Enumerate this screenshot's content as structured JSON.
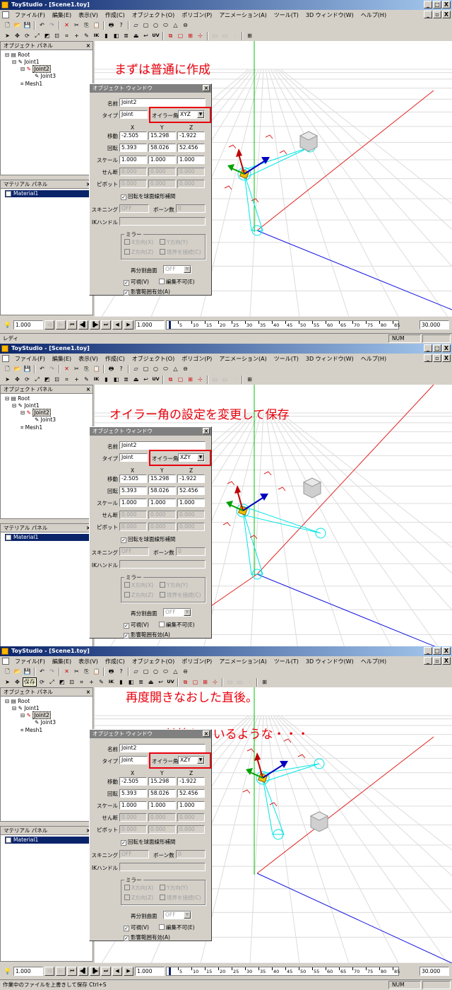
{
  "app": {
    "title": "ToyStudio - [Scene1.toy]",
    "menu": [
      "ファイル(F)",
      "編集(E)",
      "表示(V)",
      "作成(C)",
      "オブジェクト(O)",
      "ポリゴン(P)",
      "アニメーション(A)",
      "ツール(T)",
      "3D ウィンドウ(W)",
      "ヘルプ(H)"
    ],
    "window_buttons": [
      "_",
      "□",
      "X"
    ],
    "mdi_buttons": [
      "_",
      "▫",
      "X"
    ]
  },
  "object_panel": {
    "title": "オブジェクト パネル",
    "tree": [
      "Root",
      "Joint1",
      "Joint2",
      "Joint3",
      "Mesh1"
    ]
  },
  "material_panel": {
    "title": "マテリアル パネル",
    "items": [
      "Material1"
    ]
  },
  "toolbar2_extra": {
    "ik": "IK",
    "uv": "UV",
    "save_tooltip": "保存"
  },
  "timebar": {
    "start": "1.000",
    "current": "1.000",
    "end": "30.000",
    "ticks": [
      "5",
      "10",
      "15",
      "20",
      "25",
      "30",
      "35",
      "40",
      "45",
      "50",
      "55",
      "60",
      "65",
      "70",
      "75",
      "80",
      "85"
    ]
  },
  "dialog": {
    "title": "オブジェクト ウィンドウ",
    "name_label": "名前",
    "name_value": "Joint2",
    "type_label": "タイプ",
    "type_value": "Joint",
    "euler_label": "オイラー角",
    "col_x": "X",
    "col_y": "Y",
    "col_z": "Z",
    "move_label": "移動",
    "move": [
      "-2.505",
      "15.298",
      "-1.922"
    ],
    "rot_label": "回転",
    "rot": [
      "5.393",
      "58.026",
      "52.456"
    ],
    "scale_label": "スケール",
    "scale": [
      "1.000",
      "1.000",
      "1.000"
    ],
    "shear_label": "せん断",
    "shear": [
      "0.000",
      "0.000",
      "0.000"
    ],
    "pivot_label": "ピボット",
    "pivot": [
      "0.000",
      "0.000",
      "0.000"
    ],
    "slerp_label": "回転を球面線形補間",
    "skinning_label": "スキニング",
    "skinning_value": "OFF",
    "bones_label": "ボーン数",
    "bones_value": "0",
    "ik_label": "IKハンドル",
    "mirror_label": "ミラー",
    "mirror_x": "X方向(X)",
    "mirror_y": "Y方向(Y)",
    "mirror_z": "Z方向(Z)",
    "weld_label": "境界を接続(C)",
    "subdiv_label": "再分割曲面",
    "subdiv_value": "OFF",
    "visible_label": "可視(V)",
    "locked_label": "編集不可(E)",
    "influence_label": "影響範囲有効(A)"
  },
  "panes": [
    {
      "caption": "まずは普通に作成",
      "caption2": "",
      "euler": "XYZ",
      "status": "レディ"
    },
    {
      "caption": "オイラー角の設定を変更して保存",
      "caption2": "",
      "euler": "XZY",
      "status": ""
    },
    {
      "caption": "再度開きなおした直後。",
      "caption2": "XYZ で計算しているような・・・",
      "euler": "XZY",
      "status": "作業中のファイルを上書きして保存   Ctrl+S"
    }
  ],
  "colors": {
    "accent_red": "#e8000c",
    "titlebar": "#0a246a",
    "grid": "#d8d8d8",
    "joint_cyan": "#00e5e5"
  }
}
